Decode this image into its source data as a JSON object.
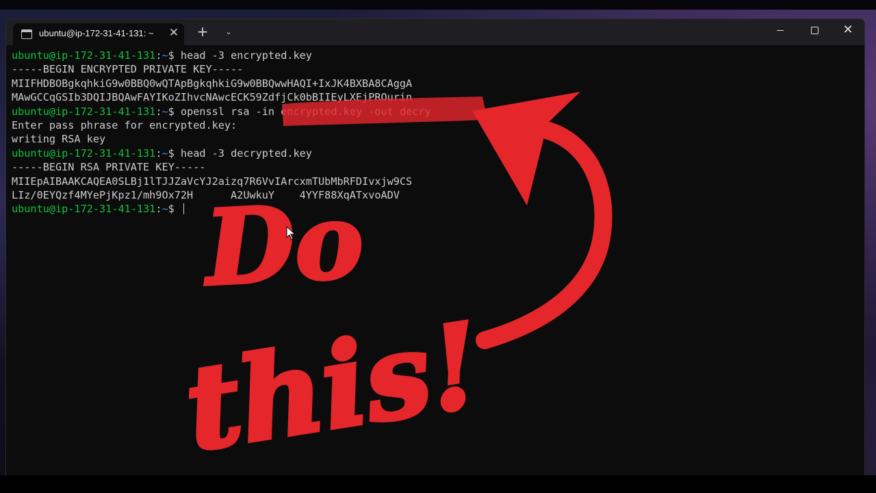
{
  "window": {
    "tab_title": "ubuntu@ip-172-31-41-131: ~",
    "tab_close": "✕",
    "new_tab": "+",
    "tab_dropdown": "⌄",
    "close_glyph": "✕",
    "icons": [
      "terminal-icon",
      "close-icon",
      "plus-icon",
      "chevron-down-icon",
      "minimize-icon",
      "maximize-icon",
      "close-window-icon"
    ]
  },
  "terminal": {
    "prompt_user": "ubuntu@ip-172-31-41-131",
    "prompt_sep": ":",
    "prompt_path": "~",
    "prompt_end": "$ ",
    "lines": [
      {
        "type": "prompt",
        "cmd": "head -3 encrypted.key"
      },
      {
        "type": "output",
        "text": "-----BEGIN ENCRYPTED PRIVATE KEY-----"
      },
      {
        "type": "output",
        "text": "MIIFHDBOBgkqhkiG9w0BBQ0wQTApBgkqhkiG9w0BBQwwHAQI+IxJK4BXBA8CAggA"
      },
      {
        "type": "output",
        "text": "MAwGCCqGSIb3DQIJBQAwFAYIKoZIhvcNAwcECK59ZdfjCk0bBIIEyLXEjPROurin"
      },
      {
        "type": "prompt",
        "cmd": "openssl rsa -in encrypted.key -out decry"
      },
      {
        "type": "output",
        "text": "Enter pass phrase for encrypted.key:"
      },
      {
        "type": "output",
        "text": "writing RSA key"
      },
      {
        "type": "prompt",
        "cmd": "head -3 decrypted.key"
      },
      {
        "type": "output",
        "text": "-----BEGIN RSA PRIVATE KEY-----"
      },
      {
        "type": "output",
        "text": "MIIEpAIBAAKCAQEA0SLBj1lTJJZaVcYJ2aizq7R6VvIArcxmTUbMbRFDIvxjw9CS"
      },
      {
        "type": "output",
        "text": "LIz/0EYQzf4MYePjKpz1/mh9Ox72H      A2UwkuY    4YYF88XqATxvoADV"
      },
      {
        "type": "prompt",
        "cmd": ""
      }
    ]
  },
  "overlay": {
    "text_line1": "Do",
    "text_line2": "this!",
    "color": "#e5262b"
  },
  "colors": {
    "terminal_bg": "#0c0c0c",
    "prompt_user": "#13c13b",
    "prompt_path": "#3b8eea",
    "text": "#cccccc",
    "annotation_red": "#e5262b"
  }
}
